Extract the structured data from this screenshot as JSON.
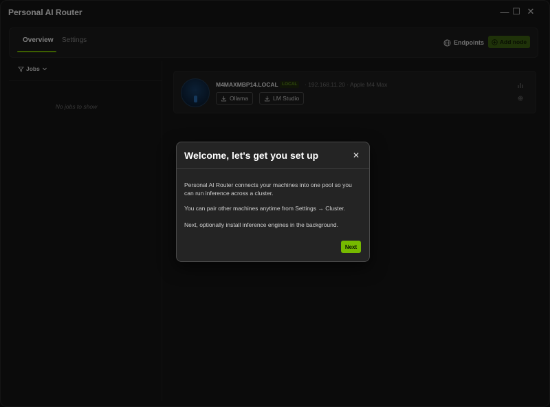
{
  "window": {
    "title": "Personal AI Router",
    "controls": {
      "minimize": "—",
      "maximize": "☐",
      "close": "✕"
    }
  },
  "tabs": [
    {
      "label": "Overview",
      "active": true
    },
    {
      "label": "Settings",
      "active": false
    }
  ],
  "toolbar": {
    "endpoints_label": "Endpoints",
    "add_node_label": "Add node"
  },
  "jobs": {
    "filter_label": "Jobs",
    "empty_text": "No jobs to show"
  },
  "node": {
    "name": "M4MAXMBP14.LOCAL",
    "badge": "LOCAL",
    "ip": "192.168.11.20",
    "chip": "Apple M4 Max",
    "engines": [
      "Ollama",
      "LM Studio"
    ]
  },
  "modal": {
    "title": "Welcome, let's get you set up",
    "paragraphs": [
      "Personal AI Router connects your machines into one pool so you can run inference across a cluster.",
      "You can pair other machines anytime from Settings → Cluster.",
      "Next, optionally install inference engines in the background."
    ],
    "next_label": "Next"
  },
  "colors": {
    "accent": "#76b900",
    "background": "#161616",
    "modal_bg": "#242424"
  }
}
